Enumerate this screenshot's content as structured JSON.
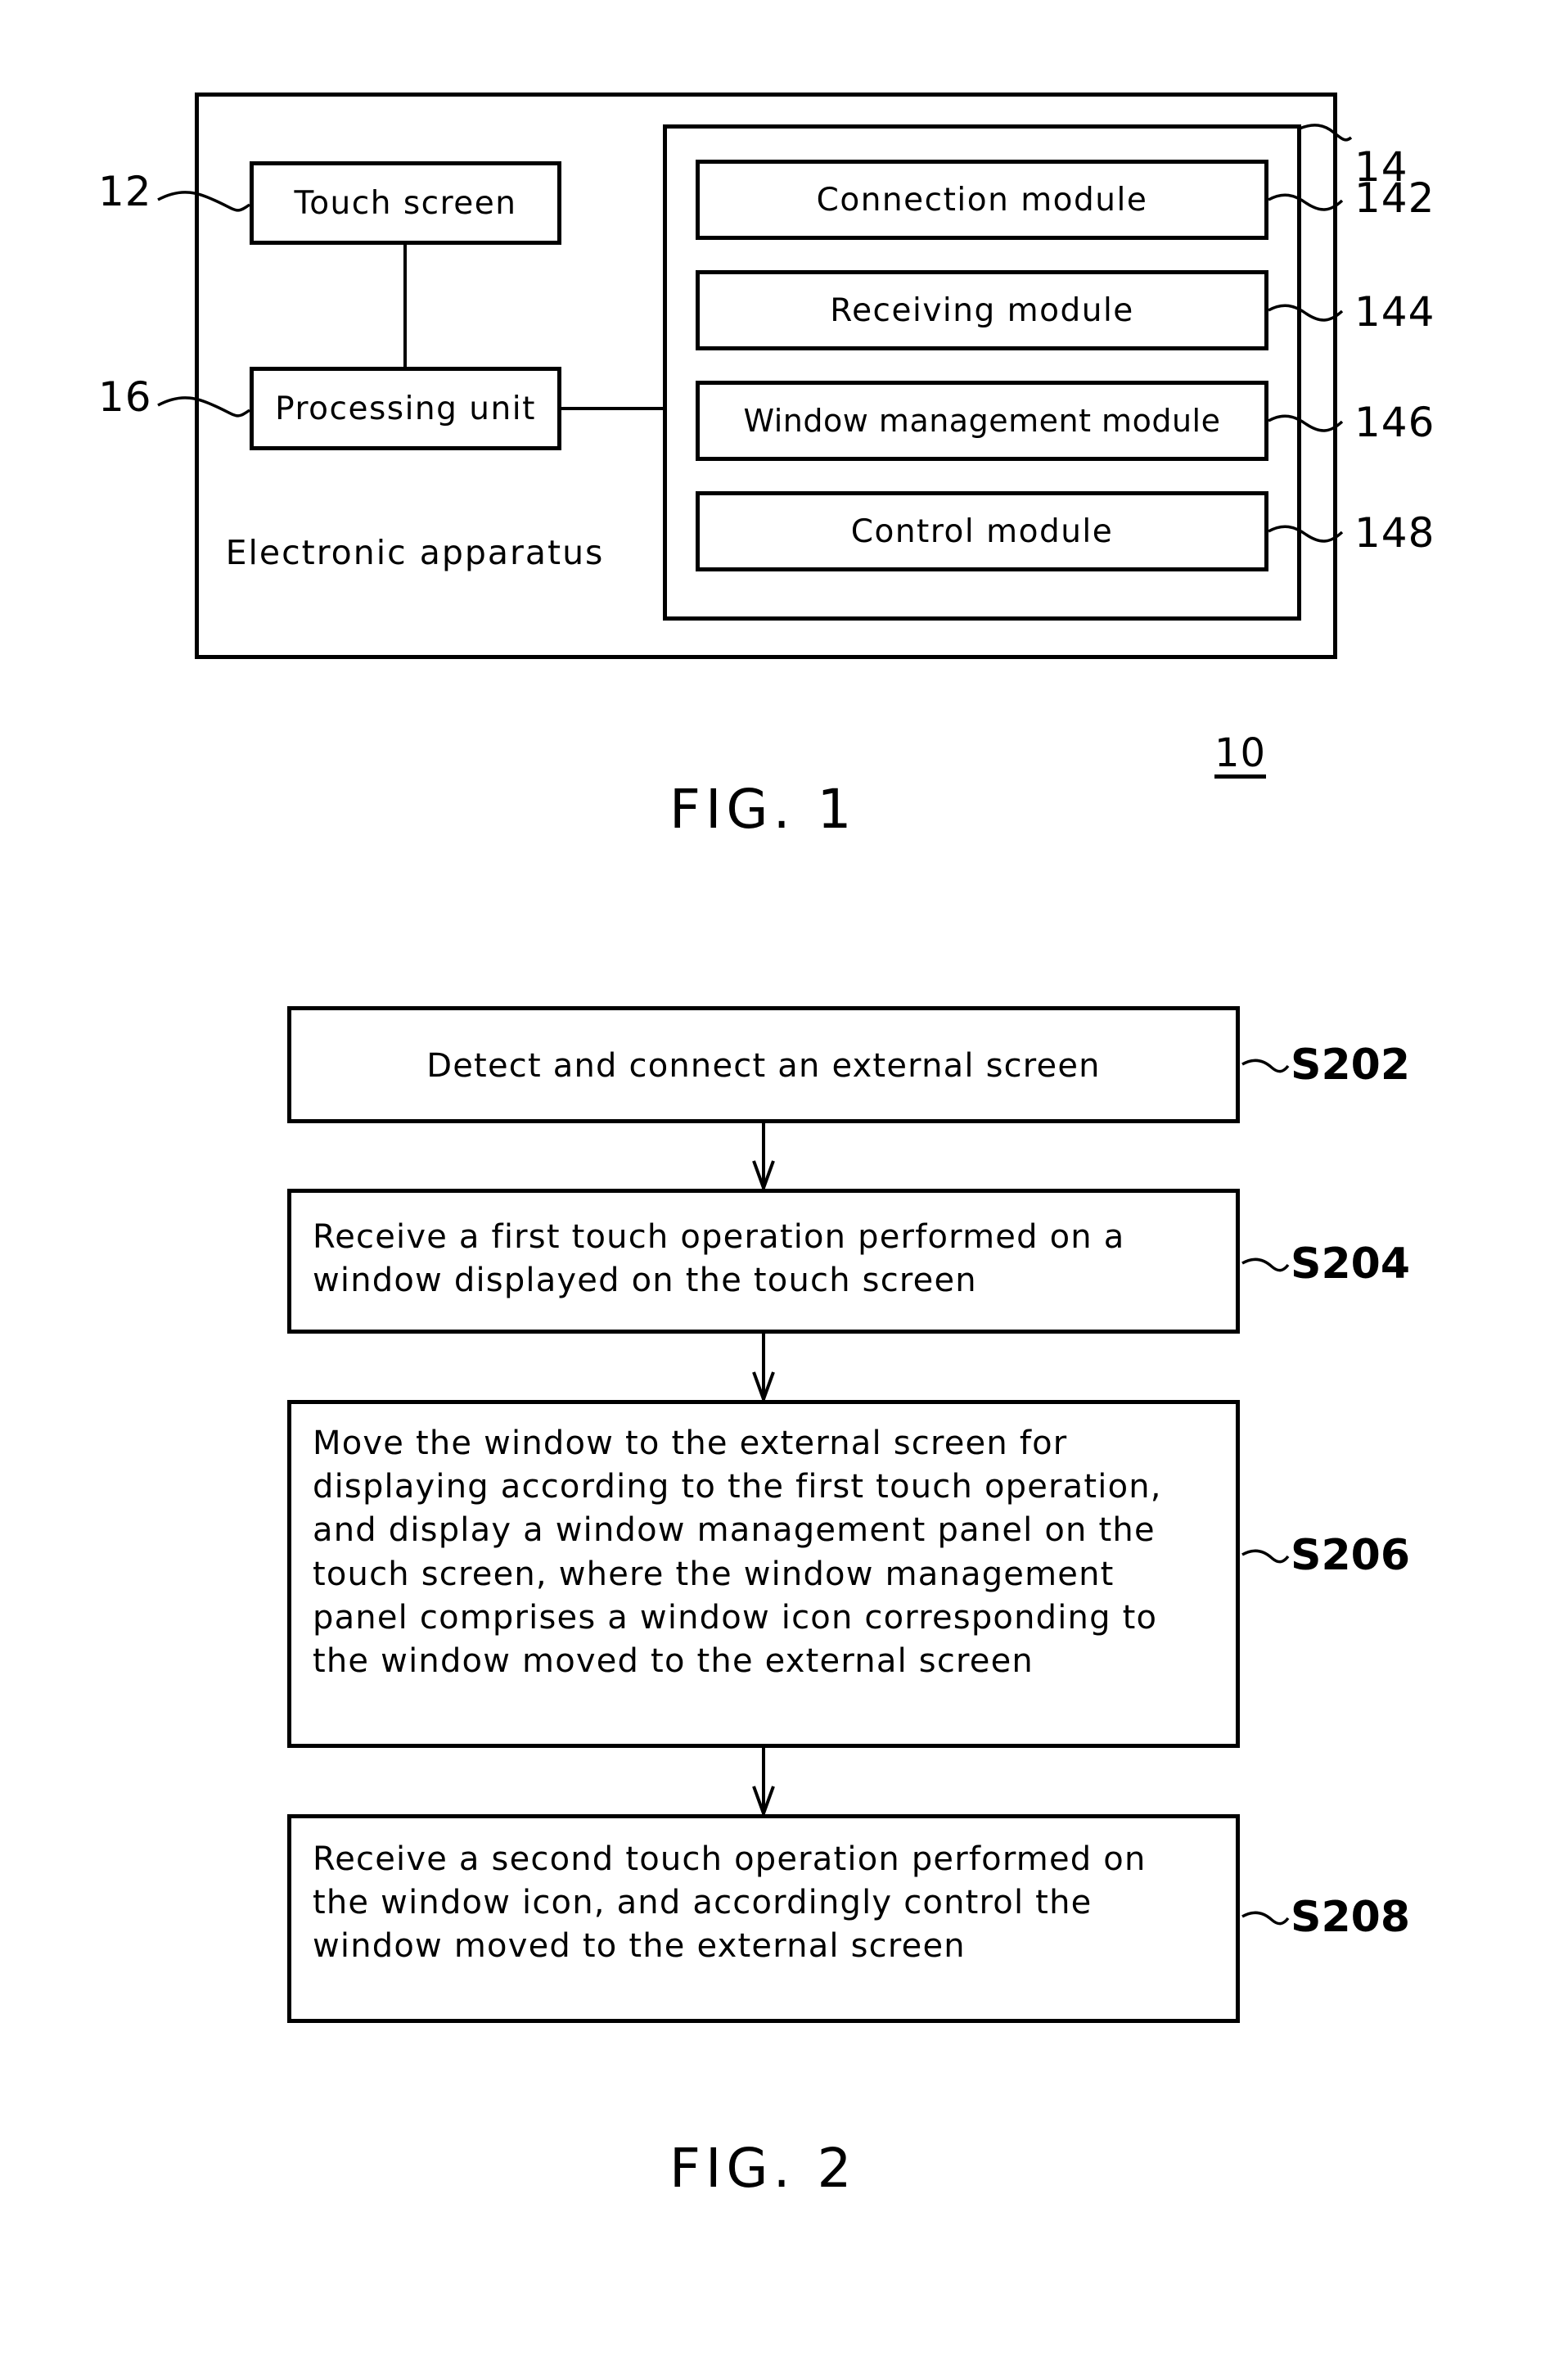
{
  "figure1": {
    "caption": "FIG. 1",
    "system_ref": "10",
    "outer_label": "Electronic apparatus",
    "outer_ref": "12_16_container",
    "blocks": [
      {
        "name": "touch-screen",
        "label": "Touch screen",
        "ref": "12"
      },
      {
        "name": "processing-unit",
        "label": "Processing unit",
        "ref": "16"
      }
    ],
    "module_group_ref": "14",
    "modules": [
      {
        "name": "connection-module",
        "label": "Connection module",
        "ref": "142"
      },
      {
        "name": "receiving-module",
        "label": "Receiving module",
        "ref": "144"
      },
      {
        "name": "window-management-module",
        "label": "Window management module",
        "ref": "146"
      },
      {
        "name": "control-module",
        "label": "Control module",
        "ref": "148"
      }
    ]
  },
  "figure2": {
    "caption": "FIG. 2",
    "steps": [
      {
        "id": "S202",
        "text": "Detect and connect an external screen"
      },
      {
        "id": "S204",
        "text": "Receive a first touch operation performed on a\nwindow displayed on the touch screen"
      },
      {
        "id": "S206",
        "text": "Move the window to the external screen for\ndisplaying according to the first touch operation,\nand display a window management panel on the\ntouch screen, where the window management\npanel comprises a window icon corresponding to\nthe window moved to the external screen"
      },
      {
        "id": "S208",
        "text": "Receive a second touch operation performed on\nthe window icon, and accordingly control the\nwindow moved to the external screen"
      }
    ]
  },
  "colors": {
    "ink": "#000000",
    "paper": "#ffffff"
  }
}
